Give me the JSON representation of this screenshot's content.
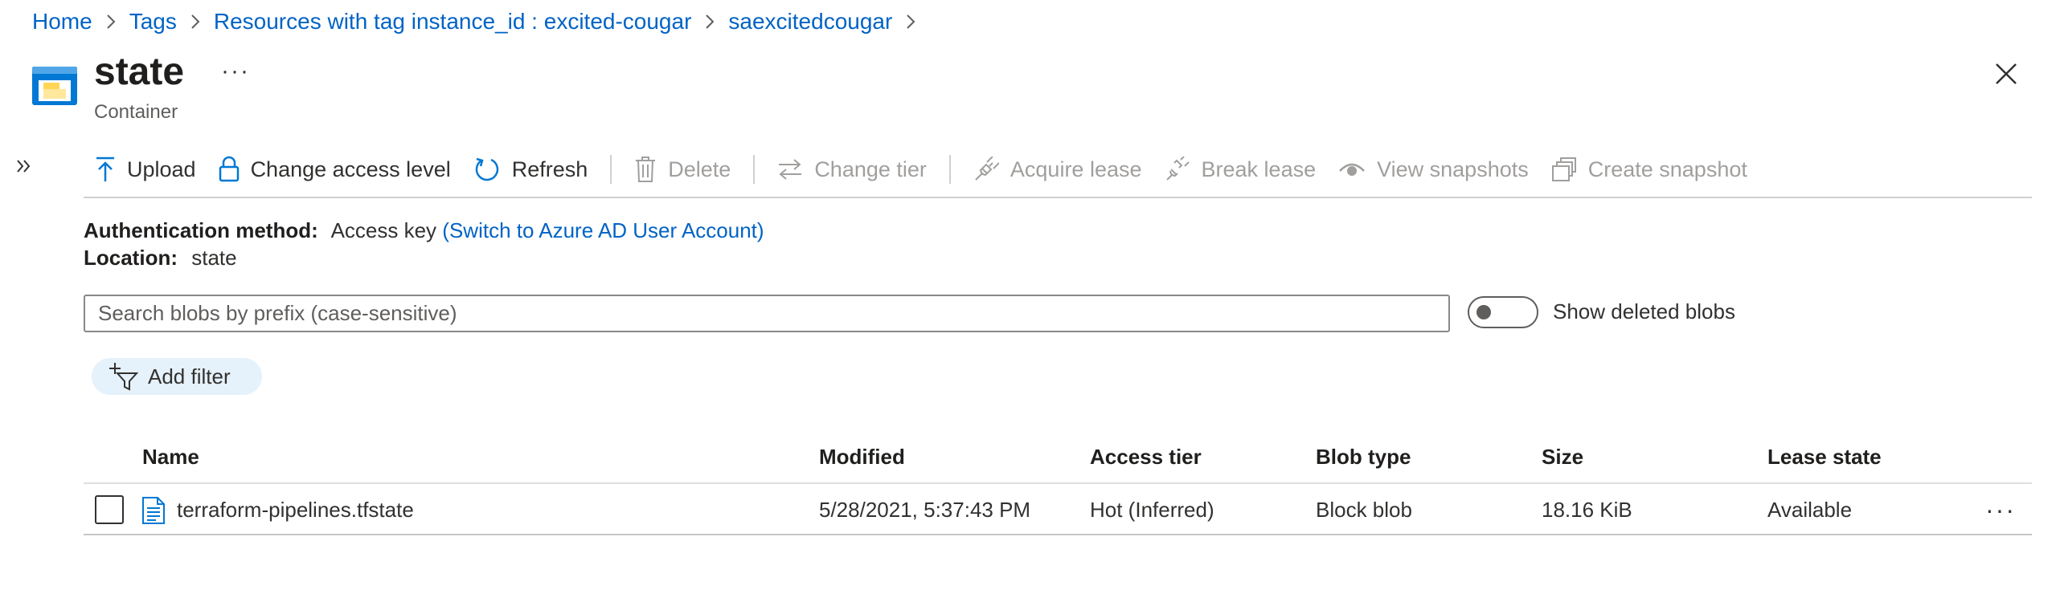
{
  "breadcrumb": [
    "Home",
    "Tags",
    "Resources with tag instance_id : excited-cougar",
    "saexcitedcougar"
  ],
  "header": {
    "title": "state",
    "subtitle": "Container",
    "more": "···"
  },
  "toolbar": {
    "upload": "Upload",
    "change_access": "Change access level",
    "refresh": "Refresh",
    "delete": "Delete",
    "change_tier": "Change tier",
    "acquire_lease": "Acquire lease",
    "break_lease": "Break lease",
    "view_snapshots": "View snapshots",
    "create_snapshot": "Create snapshot"
  },
  "info": {
    "auth_label": "Authentication method:",
    "auth_value": "Access key",
    "auth_link": "(Switch to Azure AD User Account)",
    "location_label": "Location:",
    "location_value": "state"
  },
  "search": {
    "placeholder": "Search blobs by prefix (case-sensitive)",
    "value": ""
  },
  "toggle": {
    "label": "Show deleted blobs",
    "on": false
  },
  "filter": {
    "label": "Add filter"
  },
  "table": {
    "columns": [
      "Name",
      "Modified",
      "Access tier",
      "Blob type",
      "Size",
      "Lease state"
    ],
    "rows": [
      {
        "name": "terraform-pipelines.tfstate",
        "modified": "5/28/2021, 5:37:43 PM",
        "tier": "Hot (Inferred)",
        "type": "Block blob",
        "size": "18.16 KiB",
        "lease": "Available",
        "more": "···"
      }
    ]
  },
  "colors": {
    "link": "#0063c5",
    "accent_blue": "#0078d4",
    "filter_bg": "#e5f1fb",
    "disabled": "#a19f9d"
  }
}
